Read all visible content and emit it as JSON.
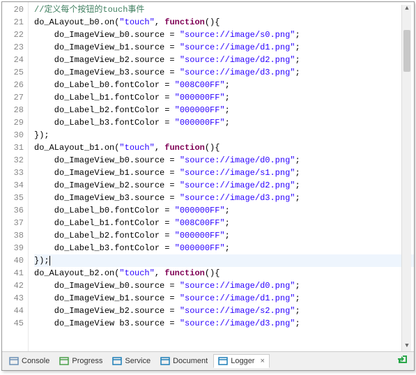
{
  "lines": [
    {
      "n": 20,
      "seg": [
        {
          "t": "//定义每个按钮的touch事件",
          "c": "c-comment"
        }
      ]
    },
    {
      "n": 21,
      "seg": [
        {
          "t": "do_ALayout_b0.on(",
          "c": "c-ident"
        },
        {
          "t": "\"touch\"",
          "c": "c-str"
        },
        {
          "t": ", ",
          "c": "c-ident"
        },
        {
          "t": "function",
          "c": "c-fn"
        },
        {
          "t": "(){",
          "c": "c-ident"
        }
      ]
    },
    {
      "n": 22,
      "seg": [
        {
          "t": "    do_ImageView_b0.source = ",
          "c": "c-ident"
        },
        {
          "t": "\"source://image/s0.png\"",
          "c": "c-str"
        },
        {
          "t": ";",
          "c": "c-semi"
        }
      ]
    },
    {
      "n": 23,
      "seg": [
        {
          "t": "    do_ImageView_b1.source = ",
          "c": "c-ident"
        },
        {
          "t": "\"source://image/d1.png\"",
          "c": "c-str"
        },
        {
          "t": ";",
          "c": "c-semi"
        }
      ]
    },
    {
      "n": 24,
      "seg": [
        {
          "t": "    do_ImageView_b2.source = ",
          "c": "c-ident"
        },
        {
          "t": "\"source://image/d2.png\"",
          "c": "c-str"
        },
        {
          "t": ";",
          "c": "c-semi"
        }
      ]
    },
    {
      "n": 25,
      "seg": [
        {
          "t": "    do_ImageView_b3.source = ",
          "c": "c-ident"
        },
        {
          "t": "\"source://image/d3.png\"",
          "c": "c-str"
        },
        {
          "t": ";",
          "c": "c-semi"
        }
      ]
    },
    {
      "n": 26,
      "seg": [
        {
          "t": "    do_Label_b0.fontColor = ",
          "c": "c-ident"
        },
        {
          "t": "\"008C00FF\"",
          "c": "c-str"
        },
        {
          "t": ";",
          "c": "c-semi"
        }
      ]
    },
    {
      "n": 27,
      "seg": [
        {
          "t": "    do_Label_b1.fontColor = ",
          "c": "c-ident"
        },
        {
          "t": "\"000000FF\"",
          "c": "c-str"
        },
        {
          "t": ";",
          "c": "c-semi"
        }
      ]
    },
    {
      "n": 28,
      "seg": [
        {
          "t": "    do_Label_b2.fontColor = ",
          "c": "c-ident"
        },
        {
          "t": "\"000000FF\"",
          "c": "c-str"
        },
        {
          "t": ";",
          "c": "c-semi"
        }
      ]
    },
    {
      "n": 29,
      "seg": [
        {
          "t": "    do_Label_b3.fontColor = ",
          "c": "c-ident"
        },
        {
          "t": "\"000000FF\"",
          "c": "c-str"
        },
        {
          "t": ";",
          "c": "c-semi"
        }
      ]
    },
    {
      "n": 30,
      "seg": [
        {
          "t": "});",
          "c": "c-ident"
        }
      ]
    },
    {
      "n": 31,
      "seg": [
        {
          "t": "do_ALayout_b1.on(",
          "c": "c-ident"
        },
        {
          "t": "\"touch\"",
          "c": "c-str"
        },
        {
          "t": ", ",
          "c": "c-ident"
        },
        {
          "t": "function",
          "c": "c-fn"
        },
        {
          "t": "(){",
          "c": "c-ident"
        }
      ]
    },
    {
      "n": 32,
      "seg": [
        {
          "t": "    do_ImageView_b0.source = ",
          "c": "c-ident"
        },
        {
          "t": "\"source://image/d0.png\"",
          "c": "c-str"
        },
        {
          "t": ";",
          "c": "c-semi"
        }
      ]
    },
    {
      "n": 33,
      "seg": [
        {
          "t": "    do_ImageView_b1.source = ",
          "c": "c-ident"
        },
        {
          "t": "\"source://image/s1.png\"",
          "c": "c-str"
        },
        {
          "t": ";",
          "c": "c-semi"
        }
      ]
    },
    {
      "n": 34,
      "seg": [
        {
          "t": "    do_ImageView_b2.source = ",
          "c": "c-ident"
        },
        {
          "t": "\"source://image/d2.png\"",
          "c": "c-str"
        },
        {
          "t": ";",
          "c": "c-semi"
        }
      ]
    },
    {
      "n": 35,
      "seg": [
        {
          "t": "    do_ImageView_b3.source = ",
          "c": "c-ident"
        },
        {
          "t": "\"source://image/d3.png\"",
          "c": "c-str"
        },
        {
          "t": ";",
          "c": "c-semi"
        }
      ]
    },
    {
      "n": 36,
      "seg": [
        {
          "t": "    do_Label_b0.fontColor = ",
          "c": "c-ident"
        },
        {
          "t": "\"000000FF\"",
          "c": "c-str"
        },
        {
          "t": ";",
          "c": "c-semi"
        }
      ]
    },
    {
      "n": 37,
      "seg": [
        {
          "t": "    do_Label_b1.fontColor = ",
          "c": "c-ident"
        },
        {
          "t": "\"008C00FF\"",
          "c": "c-str"
        },
        {
          "t": ";",
          "c": "c-semi"
        }
      ]
    },
    {
      "n": 38,
      "seg": [
        {
          "t": "    do_Label_b2.fontColor = ",
          "c": "c-ident"
        },
        {
          "t": "\"000000FF\"",
          "c": "c-str"
        },
        {
          "t": ";",
          "c": "c-semi"
        }
      ]
    },
    {
      "n": 39,
      "seg": [
        {
          "t": "    do_Label_b3.fontColor = ",
          "c": "c-ident"
        },
        {
          "t": "\"000000FF\"",
          "c": "c-str"
        },
        {
          "t": ";",
          "c": "c-semi"
        }
      ]
    },
    {
      "n": 40,
      "hl": true,
      "cursor": true,
      "seg": [
        {
          "t": "});",
          "c": "c-ident"
        }
      ]
    },
    {
      "n": 41,
      "seg": [
        {
          "t": "do_ALayout_b2.on(",
          "c": "c-ident"
        },
        {
          "t": "\"touch\"",
          "c": "c-str"
        },
        {
          "t": ", ",
          "c": "c-ident"
        },
        {
          "t": "function",
          "c": "c-fn"
        },
        {
          "t": "(){",
          "c": "c-ident"
        }
      ]
    },
    {
      "n": 42,
      "seg": [
        {
          "t": "    do_ImageView_b0.source = ",
          "c": "c-ident"
        },
        {
          "t": "\"source://image/d0.png\"",
          "c": "c-str"
        },
        {
          "t": ";",
          "c": "c-semi"
        }
      ]
    },
    {
      "n": 43,
      "seg": [
        {
          "t": "    do_ImageView_b1.source = ",
          "c": "c-ident"
        },
        {
          "t": "\"source://image/d1.png\"",
          "c": "c-str"
        },
        {
          "t": ";",
          "c": "c-semi"
        }
      ]
    },
    {
      "n": 44,
      "seg": [
        {
          "t": "    do_ImageView_b2.source = ",
          "c": "c-ident"
        },
        {
          "t": "\"source://image/s2.png\"",
          "c": "c-str"
        },
        {
          "t": ";",
          "c": "c-semi"
        }
      ]
    },
    {
      "n": 45,
      "seg": [
        {
          "t": "    do_ImageView b3.source = ",
          "c": "c-ident"
        },
        {
          "t": "\"source://image/d3.png\"",
          "c": "c-str"
        },
        {
          "t": ";",
          "c": "c-semi"
        }
      ]
    }
  ],
  "tabs": [
    {
      "label": "Console",
      "iconColor": "#6a8fb5"
    },
    {
      "label": "Progress",
      "iconColor": "#4aa04a"
    },
    {
      "label": "Service",
      "iconColor": "#1e7fb8"
    },
    {
      "label": "Document",
      "iconColor": "#1e7fb8"
    },
    {
      "label": "Logger",
      "iconColor": "#1e7fb8",
      "active": true,
      "close": "×"
    }
  ]
}
